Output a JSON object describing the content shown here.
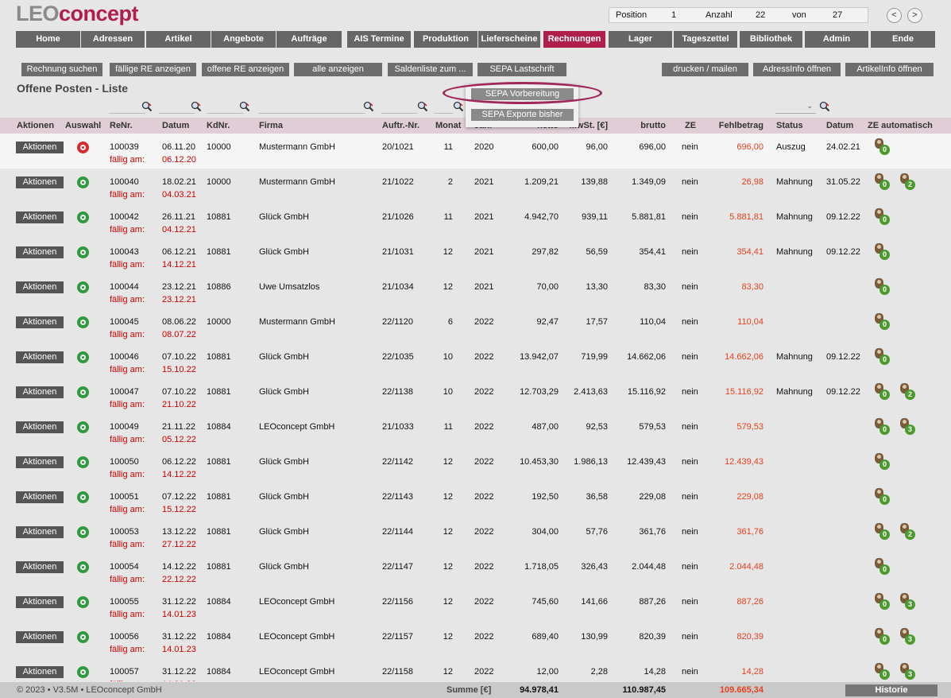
{
  "logo": {
    "part1": "LEO",
    "part2": "concept"
  },
  "position_box": {
    "position_label": "Position",
    "position_value": "1",
    "anzahl_label": "Anzahl",
    "anzahl_value": "22",
    "von_label": "von",
    "von_value": "27"
  },
  "nav_arrows": {
    "prev": "<",
    "next": ">"
  },
  "main_nav": [
    "Home",
    "Adressen",
    "Artikel",
    "Angebote",
    "Aufträge",
    "AIS Termine",
    "Produktion",
    "Lieferscheine",
    "Rechnungen",
    "Lager",
    "Tageszettel",
    "Bibliothek",
    "Admin",
    "Ende"
  ],
  "active_nav": "Rechnungen",
  "sub_buttons": [
    "Rechnung suchen",
    "fällige RE anzeigen",
    "offene RE anzeigen",
    "alle anzeigen",
    "Saldenliste zum ...",
    "SEPA Lastschrift"
  ],
  "right_buttons": [
    "drucken / mailen",
    "AdressInfo öffnen",
    "ArtikelInfo öffnen"
  ],
  "page_title": "Offene Posten - Liste",
  "dropdown": {
    "items": [
      "SEPA Vorbereitung",
      "SEPA Exporte bisher"
    ]
  },
  "columns": [
    "Aktionen",
    "Auswahl",
    "ReNr.",
    "Datum",
    "KdNr.",
    "Firma",
    "Auftr.-Nr.",
    "Monat",
    "Jahr",
    "netto",
    "MwSt. [€]",
    "brutto",
    "ZE",
    "Fehlbetrag",
    "Status",
    "Datum",
    "ZE automatisch"
  ],
  "action_label": "Aktionen",
  "due_label": "fällig am:",
  "rows": [
    {
      "renr": "100039",
      "datum": "06.11.20",
      "due": "06.12.20",
      "kdnr": "10000",
      "firma": "Mustermann GmbH",
      "auftr": "20/1021",
      "monat": "11",
      "jahr": "2020",
      "netto": "600,00",
      "mwst": "96,00",
      "brutto": "696,00",
      "ze": "nein",
      "fehl": "696,00",
      "status": "Auszug",
      "sdatum": "24.02.21",
      "dot": "red",
      "ze_auto": [
        "0"
      ]
    },
    {
      "renr": "100040",
      "datum": "18.02.21",
      "due": "04.03.21",
      "kdnr": "10000",
      "firma": "Mustermann GmbH",
      "auftr": "21/1022",
      "monat": "2",
      "jahr": "2021",
      "netto": "1.209,21",
      "mwst": "139,88",
      "brutto": "1.349,09",
      "ze": "nein",
      "fehl": "26,98",
      "status": "Mahnung",
      "sdatum": "31.05.22",
      "dot": "green",
      "ze_auto": [
        "0",
        "2"
      ]
    },
    {
      "renr": "100042",
      "datum": "26.11.21",
      "due": "04.12.21",
      "kdnr": "10881",
      "firma": "Glück GmbH",
      "auftr": "21/1026",
      "monat": "11",
      "jahr": "2021",
      "netto": "4.942,70",
      "mwst": "939,11",
      "brutto": "5.881,81",
      "ze": "nein",
      "fehl": "5.881,81",
      "status": "Mahnung",
      "sdatum": "09.12.22",
      "dot": "green",
      "ze_auto": [
        "0"
      ]
    },
    {
      "renr": "100043",
      "datum": "06.12.21",
      "due": "14.12.21",
      "kdnr": "10881",
      "firma": "Glück GmbH",
      "auftr": "21/1031",
      "monat": "12",
      "jahr": "2021",
      "netto": "297,82",
      "mwst": "56,59",
      "brutto": "354,41",
      "ze": "nein",
      "fehl": "354,41",
      "status": "Mahnung",
      "sdatum": "09.12.22",
      "dot": "green",
      "ze_auto": [
        "0"
      ]
    },
    {
      "renr": "100044",
      "datum": "23.12.21",
      "due": "23.12.21",
      "kdnr": "10886",
      "firma": "Uwe Umsatzlos",
      "auftr": "21/1034",
      "monat": "12",
      "jahr": "2021",
      "netto": "70,00",
      "mwst": "13,30",
      "brutto": "83,30",
      "ze": "nein",
      "fehl": "83,30",
      "status": "",
      "sdatum": "",
      "dot": "green",
      "ze_auto": [
        "0"
      ]
    },
    {
      "renr": "100045",
      "datum": "08.06.22",
      "due": "08.07.22",
      "kdnr": "10000",
      "firma": "Mustermann GmbH",
      "auftr": "22/1120",
      "monat": "6",
      "jahr": "2022",
      "netto": "92,47",
      "mwst": "17,57",
      "brutto": "110,04",
      "ze": "nein",
      "fehl": "110,04",
      "status": "",
      "sdatum": "",
      "dot": "green",
      "ze_auto": [
        "0"
      ]
    },
    {
      "renr": "100046",
      "datum": "07.10.22",
      "due": "15.10.22",
      "kdnr": "10881",
      "firma": "Glück GmbH",
      "auftr": "22/1035",
      "monat": "10",
      "jahr": "2022",
      "netto": "13.942,07",
      "mwst": "719,99",
      "brutto": "14.662,06",
      "ze": "nein",
      "fehl": "14.662,06",
      "status": "Mahnung",
      "sdatum": "09.12.22",
      "dot": "green",
      "ze_auto": [
        "0"
      ]
    },
    {
      "renr": "100047",
      "datum": "07.10.22",
      "due": "21.10.22",
      "kdnr": "10881",
      "firma": "Glück GmbH",
      "auftr": "22/1138",
      "monat": "10",
      "jahr": "2022",
      "netto": "12.703,29",
      "mwst": "2.413,63",
      "brutto": "15.116,92",
      "ze": "nein",
      "fehl": "15.116,92",
      "status": "Mahnung",
      "sdatum": "09.12.22",
      "dot": "green",
      "ze_auto": [
        "0",
        "2"
      ]
    },
    {
      "renr": "100049",
      "datum": "21.11.22",
      "due": "05.12.22",
      "kdnr": "10884",
      "firma": "LEOconcept GmbH",
      "auftr": "21/1033",
      "monat": "11",
      "jahr": "2022",
      "netto": "487,00",
      "mwst": "92,53",
      "brutto": "579,53",
      "ze": "nein",
      "fehl": "579,53",
      "status": "",
      "sdatum": "",
      "dot": "green",
      "ze_auto": [
        "0",
        "3"
      ]
    },
    {
      "renr": "100050",
      "datum": "06.12.22",
      "due": "14.12.22",
      "kdnr": "10881",
      "firma": "Glück GmbH",
      "auftr": "22/1142",
      "monat": "12",
      "jahr": "2022",
      "netto": "10.453,30",
      "mwst": "1.986,13",
      "brutto": "12.439,43",
      "ze": "nein",
      "fehl": "12.439,43",
      "status": "",
      "sdatum": "",
      "dot": "green",
      "ze_auto": [
        "0"
      ]
    },
    {
      "renr": "100051",
      "datum": "07.12.22",
      "due": "15.12.22",
      "kdnr": "10881",
      "firma": "Glück GmbH",
      "auftr": "22/1143",
      "monat": "12",
      "jahr": "2022",
      "netto": "192,50",
      "mwst": "36,58",
      "brutto": "229,08",
      "ze": "nein",
      "fehl": "229,08",
      "status": "",
      "sdatum": "",
      "dot": "green",
      "ze_auto": [
        "0"
      ]
    },
    {
      "renr": "100053",
      "datum": "13.12.22",
      "due": "27.12.22",
      "kdnr": "10881",
      "firma": "Glück GmbH",
      "auftr": "22/1144",
      "monat": "12",
      "jahr": "2022",
      "netto": "304,00",
      "mwst": "57,76",
      "brutto": "361,76",
      "ze": "nein",
      "fehl": "361,76",
      "status": "",
      "sdatum": "",
      "dot": "green",
      "ze_auto": [
        "0",
        "2"
      ]
    },
    {
      "renr": "100054",
      "datum": "14.12.22",
      "due": "22.12.22",
      "kdnr": "10881",
      "firma": "Glück GmbH",
      "auftr": "22/1147",
      "monat": "12",
      "jahr": "2022",
      "netto": "1.718,05",
      "mwst": "326,43",
      "brutto": "2.044,48",
      "ze": "nein",
      "fehl": "2.044,48",
      "status": "",
      "sdatum": "",
      "dot": "green",
      "ze_auto": [
        "0"
      ]
    },
    {
      "renr": "100055",
      "datum": "31.12.22",
      "due": "14.01.23",
      "kdnr": "10884",
      "firma": "LEOconcept GmbH",
      "auftr": "22/1156",
      "monat": "12",
      "jahr": "2022",
      "netto": "745,60",
      "mwst": "141,66",
      "brutto": "887,26",
      "ze": "nein",
      "fehl": "887,26",
      "status": "",
      "sdatum": "",
      "dot": "green",
      "ze_auto": [
        "0",
        "3"
      ]
    },
    {
      "renr": "100056",
      "datum": "31.12.22",
      "due": "14.01.23",
      "kdnr": "10884",
      "firma": "LEOconcept GmbH",
      "auftr": "22/1157",
      "monat": "12",
      "jahr": "2022",
      "netto": "689,40",
      "mwst": "130,99",
      "brutto": "820,39",
      "ze": "nein",
      "fehl": "820,39",
      "status": "",
      "sdatum": "",
      "dot": "green",
      "ze_auto": [
        "0",
        "3"
      ]
    },
    {
      "renr": "100057",
      "datum": "31.12.22",
      "due": "14.01.23",
      "kdnr": "10884",
      "firma": "LEOconcept GmbH",
      "auftr": "22/1158",
      "monat": "12",
      "jahr": "2022",
      "netto": "12,00",
      "mwst": "2,28",
      "brutto": "14,28",
      "ze": "nein",
      "fehl": "14,28",
      "status": "",
      "sdatum": "",
      "dot": "green",
      "ze_auto": [
        "0",
        "3"
      ]
    }
  ],
  "footer": {
    "copyright": "© 2023 • V3.5M • LEOconcept GmbH",
    "summe_label": "Summe [€]",
    "netto_sum": "94.978,41",
    "brutto_sum": "110.987,45",
    "fehl_sum": "109.665,34",
    "historie": "Historie"
  },
  "colors": {
    "accent": "#b01e4c",
    "nav": "#666666",
    "header_row": "#e0cdd6",
    "due_red": "#cc0000",
    "fehl_orange": "#e8401c"
  }
}
